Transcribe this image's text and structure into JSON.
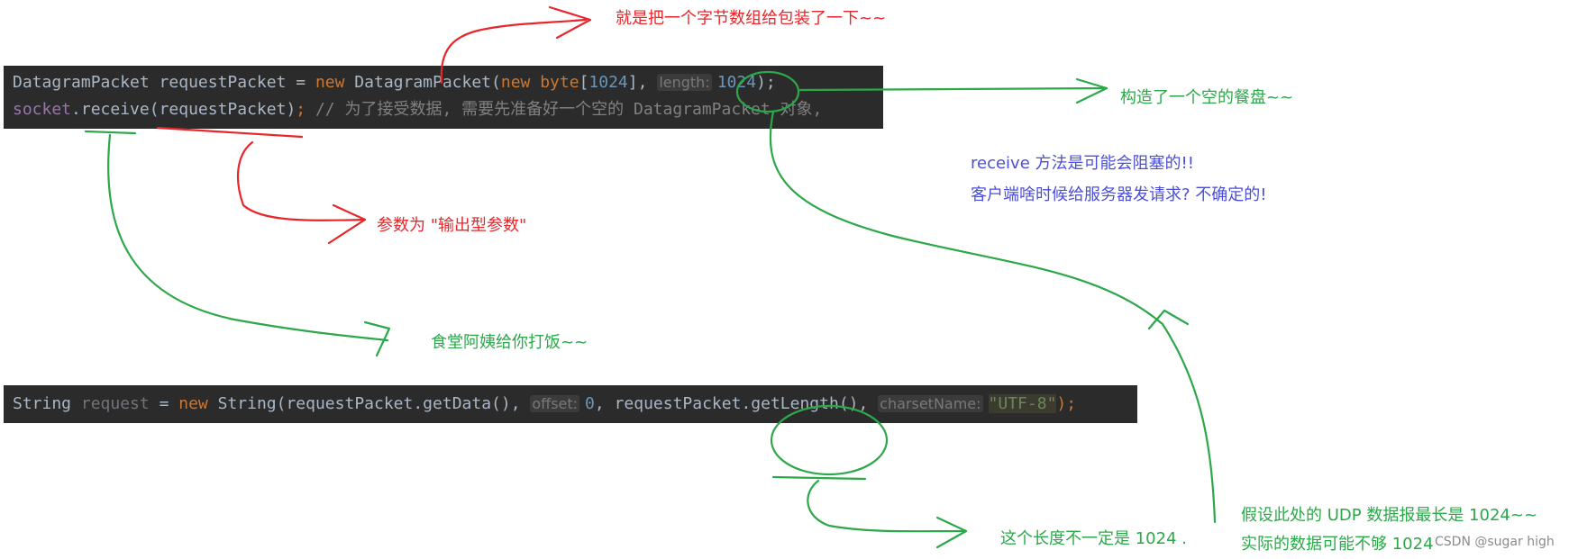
{
  "code_block_1": {
    "line1": {
      "type1": "DatagramPacket",
      "var1": " requestPacket = ",
      "kw_new1": "new",
      "ctor1": " DatagramPacket(",
      "kw_new2": "new",
      "sp": " ",
      "kw_byte": "byte",
      "br_open": "[",
      "size": "1024",
      "br_close": "],",
      "hint_length": "length:",
      "length_val": "1024",
      "end": ");"
    },
    "line2": {
      "socket": "socket",
      "call": ".receive(requestPacket)",
      "semi": ";",
      "comment": " // 为了接受数据, 需要先准备好一个空的 DatagramPacket 对象,"
    }
  },
  "code_block_2": {
    "line1": {
      "type": "String",
      "sp": " ",
      "var": "request",
      "eq": " = ",
      "kw_new": "new",
      "ctor": " String(requestPacket.getData(),",
      "hint_offset": "offset:",
      "offset_val": "0",
      "mid": ", requestPacket.getLength(),",
      "hint_charset": "charsetName:",
      "charset_val": "\"UTF-8\"",
      "end": ");"
    }
  },
  "annotations": {
    "wrap_bytes": "就是把一个字节数组给包装了一下~~",
    "empty_plate": "构造了一个空的餐盘~~",
    "receive_blocking_1": "receive 方法是可能会阻塞的!!",
    "receive_blocking_2": "客户端啥时候给服务器发请求? 不确定的!",
    "output_param": "参数为 \"输出型参数\"",
    "canteen": "食堂阿姨给你打饭~~",
    "length_not_1024": "这个长度不一定是 1024 .",
    "udp_max_1": "假设此处的 UDP 数据报最长是 1024~~",
    "udp_max_2": "实际的数据可能不够 1024"
  },
  "watermark": "CSDN @sugar high",
  "colors": {
    "red": "#e8262b",
    "green": "#2ca84a",
    "blue": "#4b4fd8",
    "code_bg": "#2b2b2b"
  }
}
